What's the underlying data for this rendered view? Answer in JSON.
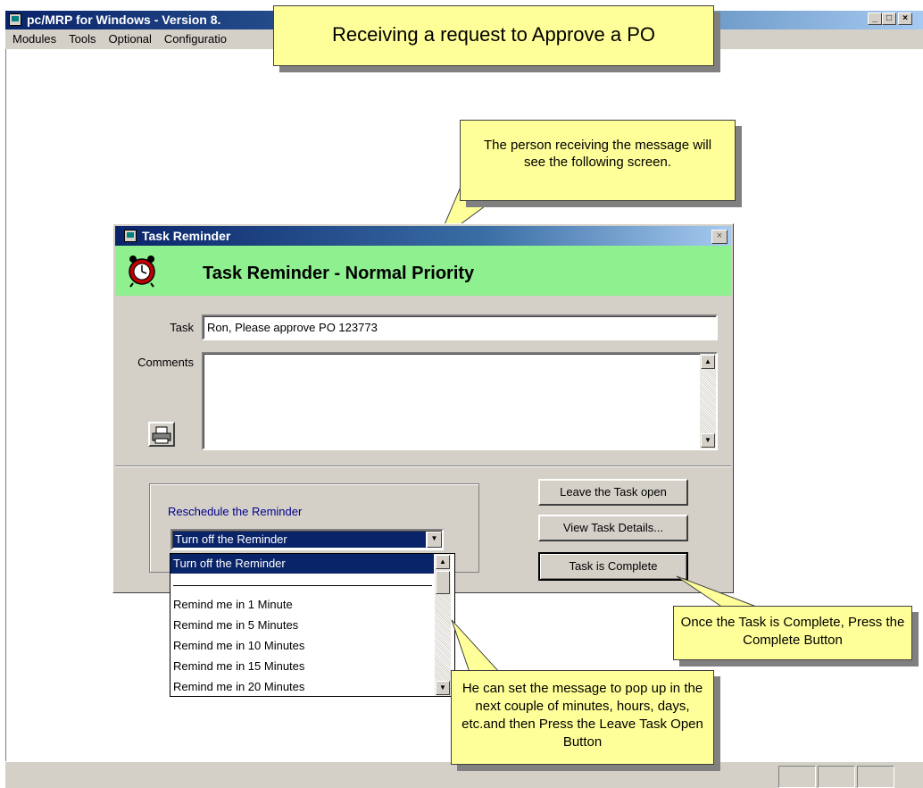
{
  "app": {
    "title": "pc/MRP for Windows - Version 8.",
    "menu": [
      "Modules",
      "Tools",
      "Optional",
      "Configuratio"
    ]
  },
  "callouts": {
    "header": "Receiving a request to Approve a PO",
    "screen_note": "The person receiving the message will see the following screen.",
    "complete_note": "Once the Task is Complete, Press the Complete Button",
    "schedule_note": "He can set the message to pop up in the next couple of minutes, hours, days, etc.and then Press the Leave Task Open Button"
  },
  "dialog": {
    "title": "Task Reminder",
    "priority_heading": "Task Reminder  -  Normal Priority",
    "task_label": "Task",
    "task_value": "Ron, Please approve PO 123773",
    "comments_label": "Comments",
    "comments_value": "",
    "reschedule_label": "Reschedule the Reminder",
    "reschedule_selected": "Turn off the Reminder",
    "leave_open_button": "Leave the Task open",
    "view_details_button": "View Task Details...",
    "complete_button": "Task is Complete"
  },
  "dropdown_options": [
    "Turn off the Reminder",
    "",
    "Remind me in 1 Minute",
    "Remind me in 5 Minutes",
    "Remind me in 10 Minutes",
    "Remind me in 15 Minutes",
    "Remind me in 20 Minutes"
  ],
  "colors": {
    "title_bar": "#0a246a",
    "priority_band": "#8ff08f",
    "callout": "#ffff99",
    "selection": "#0a246a"
  },
  "icons": [
    "app-icon",
    "alarm-clock-icon",
    "printer-icon",
    "close-icon",
    "minimize-icon",
    "maximize-icon"
  ]
}
